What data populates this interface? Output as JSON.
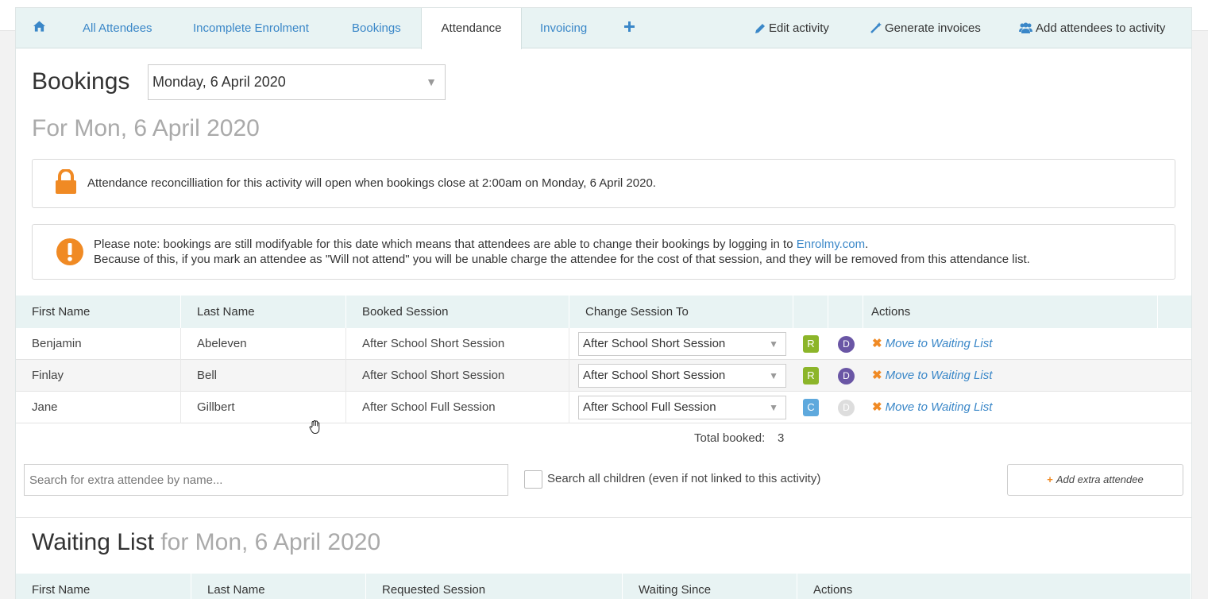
{
  "tabs": {
    "home_icon": "home-icon",
    "items": [
      {
        "label": "All Attendees"
      },
      {
        "label": "Incomplete Enrolment"
      },
      {
        "label": "Bookings"
      },
      {
        "label": "Attendance"
      },
      {
        "label": "Invoicing"
      }
    ],
    "add_icon": "plus-icon",
    "actions": [
      {
        "label": "Edit activity",
        "icon": "pencil-icon"
      },
      {
        "label": "Generate invoices",
        "icon": "magic-wand-icon"
      },
      {
        "label": "Add attendees to activity",
        "icon": "users-icon"
      }
    ]
  },
  "bookings": {
    "title": "Bookings",
    "date_selected": "Monday, 6 April 2020",
    "subtitle": "For Mon, 6 April 2020"
  },
  "alerts": {
    "lock": {
      "icon": "lock-icon",
      "text": "Attendance reconcilliation for this activity will open when bookings close at 2:00am on Monday, 6 April 2020."
    },
    "note": {
      "icon": "exclamation-icon",
      "line1_prefix": "Please note: bookings are still modifyable for this date which means that attendees are able to change their bookings by logging in to ",
      "link": "Enrolmy.com",
      "line1_suffix": ".",
      "line2": "Because of this, if you mark an attendee as \"Will not attend\" you will be unable charge the attendee for the cost of that session, and they will be removed from this attendance list."
    }
  },
  "attendance_table": {
    "headers": {
      "first_name": "First Name",
      "last_name": "Last Name",
      "booked_session": "Booked Session",
      "change_session": "Change Session To",
      "actions": "Actions"
    },
    "rows": [
      {
        "first": "Benjamin",
        "last": "Abeleven",
        "booked": "After School Short Session",
        "change": "After School Short Session",
        "badge1": "R",
        "badge1_color": "#8cb52a",
        "badge2": "D",
        "badge2_color": "#6a56a5",
        "action": "Move to Waiting List"
      },
      {
        "first": "Finlay",
        "last": "Bell",
        "booked": "After School Short Session",
        "change": "After School Short Session",
        "badge1": "R",
        "badge1_color": "#8cb52a",
        "badge2": "D",
        "badge2_color": "#6a56a5",
        "action": "Move to Waiting List"
      },
      {
        "first": "Jane",
        "last": "Gillbert",
        "booked": "After School Full Session",
        "change": "After School Full Session",
        "badge1": "C",
        "badge1_color": "#5ea9dd",
        "badge2": "D",
        "badge2_color": "#dddddd",
        "action": "Move to Waiting List"
      }
    ],
    "total_label": "Total booked:",
    "total_value": "3"
  },
  "extra_attendee": {
    "search_placeholder": "Search for extra attendee by name...",
    "checkbox_label": "Search all children (even if not linked to this activity)",
    "add_button": "Add extra attendee"
  },
  "waiting_list": {
    "title": "Waiting List",
    "subtitle": "for Mon, 6 April 2020",
    "headers": {
      "first_name": "First Name",
      "last_name": "Last Name",
      "requested_session": "Requested Session",
      "waiting_since": "Waiting Since",
      "actions": "Actions"
    }
  },
  "colors": {
    "accent_link": "#3a87c8",
    "warning_orange": "#f08a24",
    "header_bg": "#e8f3f3"
  }
}
